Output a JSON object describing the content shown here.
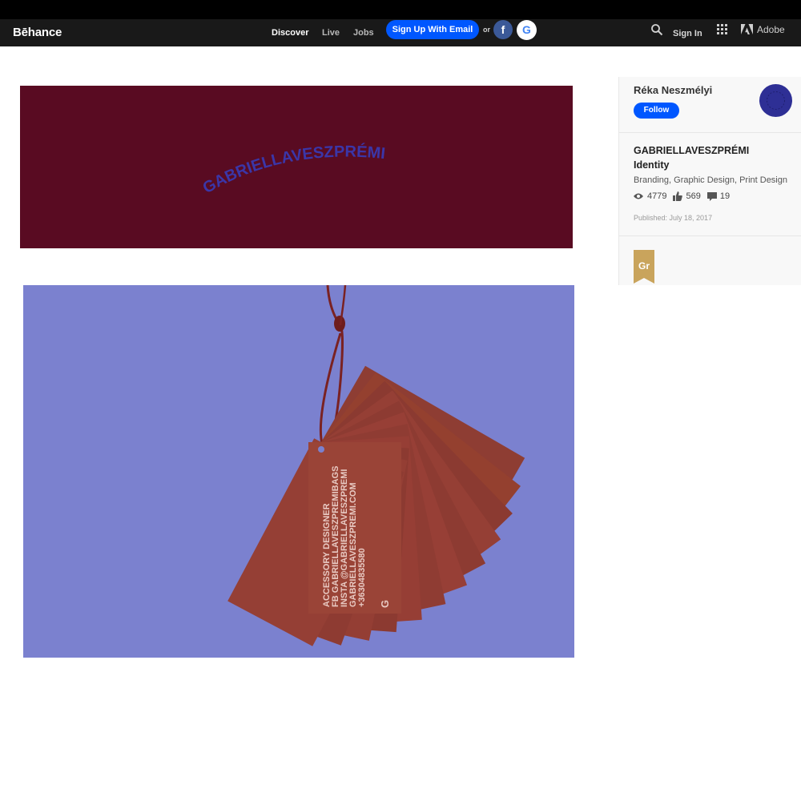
{
  "header": {
    "logo": "Bēhance",
    "nav": {
      "discover": "Discover",
      "live": "Live",
      "jobs": "Jobs"
    },
    "signup_label": "Sign Up With Email",
    "or_text": "or",
    "facebook_glyph": "f",
    "google_glyph": "G",
    "signin_label": "Sign In",
    "adobe_label": "Adobe"
  },
  "banner": {
    "wordmark": "GABRIELLAVESZPRÉMI",
    "bg_color": "#590b22",
    "text_color": "#3b36a8"
  },
  "photo": {
    "bg_color": "#7b81cf",
    "tag_color": "#9a4437",
    "tag_text": {
      "line1": "ACCESSORY DESIGNER",
      "line2": "FB GABRIELLAVESZPREMIBAGS",
      "line3": "INSTA @GABRIELLAVESZPREMI",
      "line4": "GABRIELLAVESZPREMI.COM",
      "line5": "+36304835580",
      "mark": "G"
    }
  },
  "sidebar": {
    "owner_name": "Réka Neszmélyi",
    "follow_label": "Follow",
    "project_title": "GABRIELLAVESZPRÉMI",
    "project_subtitle": "Identity",
    "fields": "Branding, Graphic Design, Print Design",
    "stats": {
      "views": "4779",
      "appreciations": "569",
      "comments": "19"
    },
    "published": "Published: July 18, 2017",
    "badge_text": "Gr",
    "badge_color": "#c9a45c"
  }
}
